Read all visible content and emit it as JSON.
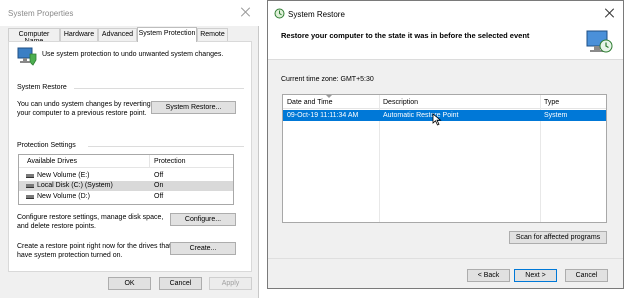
{
  "system_properties": {
    "title": "System Properties",
    "tabs": [
      "Computer Name",
      "Hardware",
      "Advanced",
      "System Protection",
      "Remote"
    ],
    "active_tab": "System Protection",
    "intro": "Use system protection to undo unwanted system changes.",
    "restore_section": {
      "heading": "System Restore",
      "text_line1": "You can undo system changes by reverting",
      "text_line2": "your computer to a previous restore point.",
      "button": "System Restore..."
    },
    "protection_section": {
      "heading": "Protection Settings",
      "col_drives": "Available Drives",
      "col_protection": "Protection",
      "drives": [
        {
          "name": "New Volume (E:)",
          "protection": "Off"
        },
        {
          "name": "Local Disk (C:) (System)",
          "protection": "On"
        },
        {
          "name": "New Volume (D:)",
          "protection": "Off"
        }
      ],
      "configure_text_line1": "Configure restore settings, manage disk space,",
      "configure_text_line2": "and delete restore points.",
      "configure_button": "Configure...",
      "create_text_line1": "Create a restore point right now for the drives that",
      "create_text_line2": "have system protection turned on.",
      "create_button": "Create..."
    },
    "footer": {
      "ok": "OK",
      "cancel": "Cancel",
      "apply": "Apply"
    }
  },
  "system_restore": {
    "title": "System Restore",
    "heading": "Restore your computer to the state it was in before the selected event",
    "timezone": "Current time zone: GMT+5:30",
    "columns": [
      "Date and Time",
      "Description",
      "Type"
    ],
    "rows": [
      {
        "date": "09-Oct-19 11:11:34 AM",
        "description": "Automatic Restore Point",
        "type": "System"
      }
    ],
    "scan_button": "Scan for affected programs",
    "back_button": "< Back",
    "next_button": "Next >",
    "cancel_button": "Cancel"
  },
  "colors": {
    "selection": "#0078d7",
    "window_bg": "#f0f0f0"
  }
}
